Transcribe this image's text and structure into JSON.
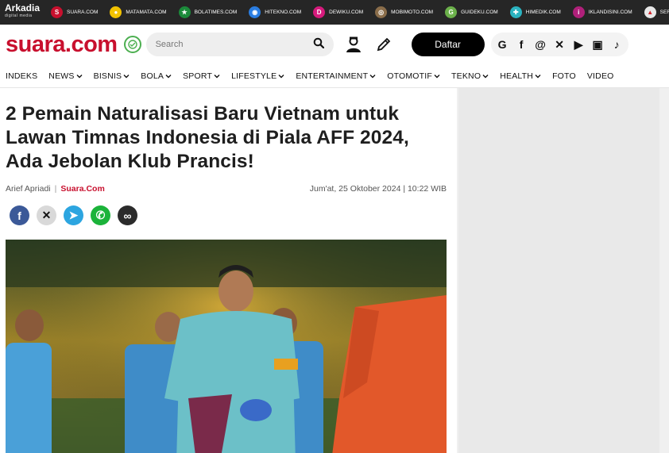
{
  "network": {
    "brand": "Arkadia",
    "brand_sub": "digital media",
    "sites": [
      {
        "name": "SUARA.COM",
        "icon": "suara-icon",
        "color": "#c8102e",
        "glyph": "S"
      },
      {
        "name": "MATAMATA.COM",
        "icon": "matamata-icon",
        "color": "#f2c200",
        "glyph": "●"
      },
      {
        "name": "BOLATIMES.COM",
        "icon": "bolatimes-icon",
        "color": "#1b8a3a",
        "glyph": "★"
      },
      {
        "name": "HITEKNO.COM",
        "icon": "hitekno-icon",
        "color": "#2a7de1",
        "glyph": "◉"
      },
      {
        "name": "DEWIKU.COM",
        "icon": "dewiku-icon",
        "color": "#d61a7c",
        "glyph": "D"
      },
      {
        "name": "MOBIMOTO.COM",
        "icon": "mobimoto-icon",
        "color": "#8a6d4a",
        "glyph": "◎"
      },
      {
        "name": "GUIDEKU.COM",
        "icon": "guideku-icon",
        "color": "#6bb04a",
        "glyph": "G"
      },
      {
        "name": "HIMEDIK.COM",
        "icon": "himedik-icon",
        "color": "#2bb3c0",
        "glyph": "✚"
      },
      {
        "name": "IKLANDISINI.COM",
        "icon": "iklandisini-icon",
        "color": "#b0207a",
        "glyph": "i"
      },
      {
        "name": "SERBADA.COM",
        "icon": "serbada-icon",
        "color": "#e8e8e8",
        "glyph": "▲"
      }
    ]
  },
  "header": {
    "logo": "suara.com",
    "search_placeholder": "Search",
    "register_label": "Daftar",
    "socials": [
      {
        "icon": "google-icon",
        "glyph": "G"
      },
      {
        "icon": "facebook-icon",
        "glyph": "f"
      },
      {
        "icon": "threads-icon",
        "glyph": "@"
      },
      {
        "icon": "x-icon",
        "glyph": "✕"
      },
      {
        "icon": "youtube-icon",
        "glyph": "▶"
      },
      {
        "icon": "instagram-icon",
        "glyph": "▣"
      },
      {
        "icon": "tiktok-icon",
        "glyph": "♪"
      }
    ]
  },
  "nav": {
    "items": [
      {
        "label": "INDEKS",
        "dropdown": false
      },
      {
        "label": "NEWS",
        "dropdown": true
      },
      {
        "label": "BISNIS",
        "dropdown": true
      },
      {
        "label": "BOLA",
        "dropdown": true
      },
      {
        "label": "SPORT",
        "dropdown": true
      },
      {
        "label": "LIFESTYLE",
        "dropdown": true
      },
      {
        "label": "ENTERTAINMENT",
        "dropdown": true
      },
      {
        "label": "OTOMOTIF",
        "dropdown": true
      },
      {
        "label": "TEKNO",
        "dropdown": true
      },
      {
        "label": "HEALTH",
        "dropdown": true
      },
      {
        "label": "FOTO",
        "dropdown": false
      },
      {
        "label": "VIDEO",
        "dropdown": false
      }
    ]
  },
  "article": {
    "title": "2 Pemain Naturalisasi Baru Vietnam untuk Lawan Timnas Indonesia di Piala AFF 2024, Ada Jebolan Klub Prancis!",
    "author": "Arief Apriadi",
    "source": "Suara.Com",
    "date": "Jum'at, 25 Oktober 2024 | 10:22 WIB"
  },
  "share": [
    {
      "icon": "facebook-share-icon",
      "color": "#3b5998",
      "glyph": "f"
    },
    {
      "icon": "x-share-icon",
      "color": "#d9d9d9",
      "glyph": "✕"
    },
    {
      "icon": "telegram-share-icon",
      "color": "#2ca5e0",
      "glyph": "➤"
    },
    {
      "icon": "whatsapp-share-icon",
      "color": "#1bb33a",
      "glyph": "✆"
    },
    {
      "icon": "copy-link-icon",
      "color": "#2b2b2b",
      "glyph": "∞"
    }
  ],
  "colors": {
    "brand_red": "#c8102e",
    "topbar": "#262626"
  }
}
